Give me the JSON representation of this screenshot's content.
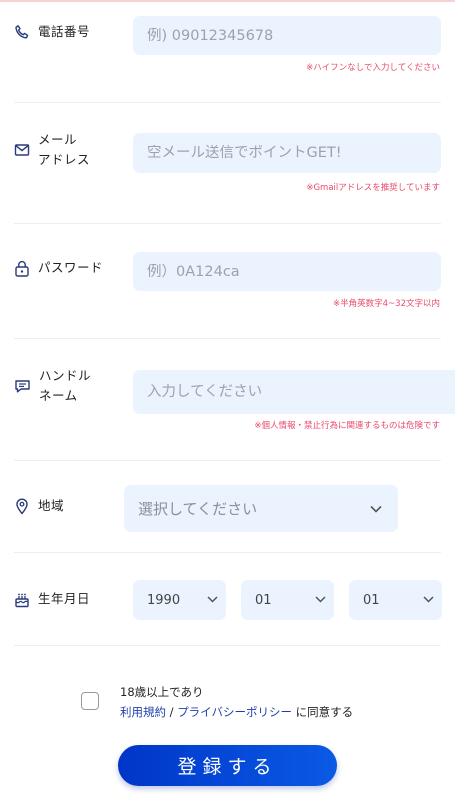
{
  "phone": {
    "label": "電話番号",
    "placeholder": "例) 09012345678",
    "note": "※ハイフンなしで入力してください"
  },
  "email": {
    "label": "メール\nアドレス",
    "placeholder": "空メール送信でポイントGET!",
    "note": "※Gmailアドレスを推奨しています"
  },
  "password": {
    "label": "パスワード",
    "placeholder": "例）0A124ca",
    "note": "※半角英数字4~32文字以内"
  },
  "handle": {
    "label": "ハンドル\nネーム",
    "placeholder": "入力してください",
    "note": "※個人情報・禁止行為に関連するものは危険です"
  },
  "region": {
    "label": "地域",
    "selected": "選択してください"
  },
  "birthday": {
    "label": "生年月日",
    "year": "1990",
    "month": "01",
    "day": "01"
  },
  "agreement": {
    "line1": "18歳以上であり",
    "terms_link": "利用規約",
    "separator": " / ",
    "privacy_link": "プライバシーポリシー",
    "suffix": " に同意する"
  },
  "submit_label": "登録する",
  "colors": {
    "field_bg": "#eaf3fe",
    "note_red": "#ea4a6a",
    "link_blue": "#1f3fae",
    "button_blue": "#0a4bd8",
    "icon_navy": "#2a3a7a"
  }
}
